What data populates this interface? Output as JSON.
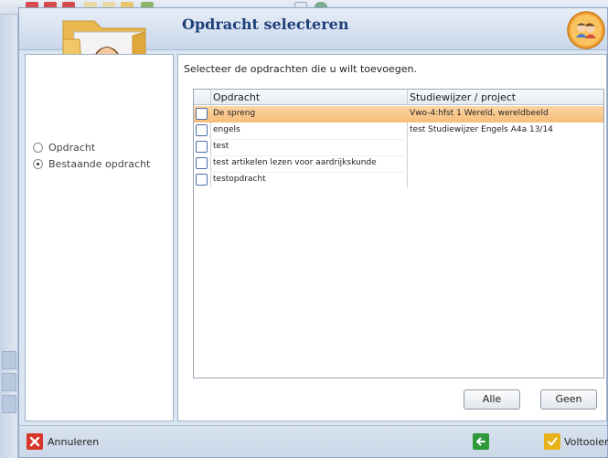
{
  "dialog": {
    "title": "Opdracht selecteren"
  },
  "options": [
    {
      "label": "Opdracht",
      "checked": false
    },
    {
      "label": "Bestaande opdracht",
      "checked": true
    }
  ],
  "instruction": "Selecteer de opdrachten die u wilt toevoegen.",
  "grid": {
    "columns": [
      "Opdracht",
      "Studiewijzer / project"
    ],
    "rows": [
      {
        "opdracht": "De spreng",
        "studiewijzer": "Vwo-4:hfst 1 Wereld, wereldbeeld",
        "selected": true
      },
      {
        "opdracht": "engels",
        "studiewijzer": "test Studiewijzer Engels A4a 13/14",
        "selected": false
      },
      {
        "opdracht": "test",
        "studiewijzer": "",
        "selected": false
      },
      {
        "opdracht": "test artikelen lezen voor aardrijkskunde",
        "studiewijzer": "",
        "selected": false
      },
      {
        "opdracht": "testopdracht",
        "studiewijzer": "",
        "selected": false
      }
    ]
  },
  "buttons": {
    "alle": "Alle",
    "geen": "Geen"
  },
  "footer": {
    "cancel": "Annuleren",
    "finish": "Voltooien"
  },
  "colors": {
    "selected_row": "#f9c68b",
    "title": "#1f3f7a",
    "cancel_icon": "#d9362b",
    "back_icon": "#2e9a3c",
    "finish_icon": "#e8b21c"
  }
}
